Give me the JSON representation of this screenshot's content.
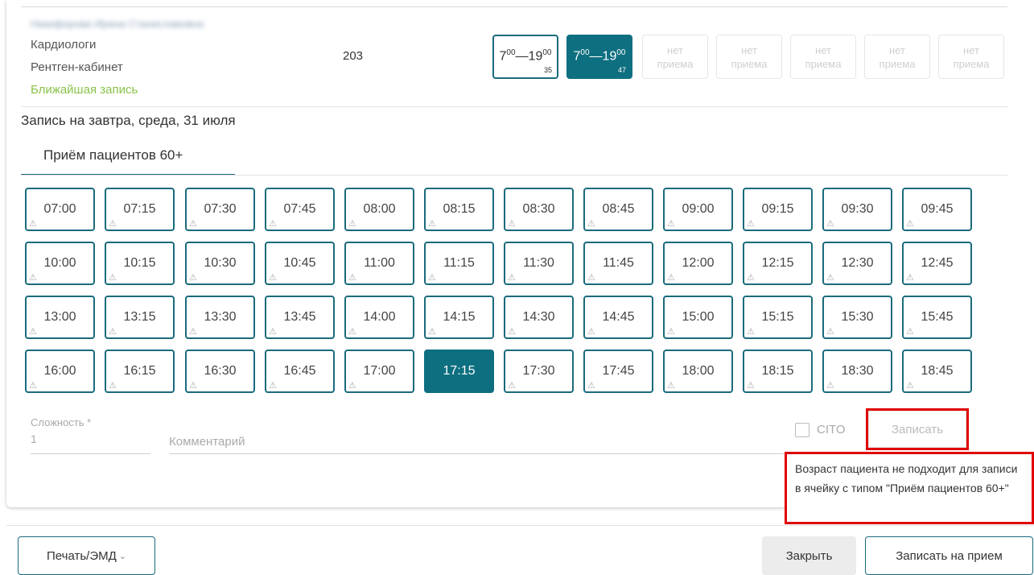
{
  "doctor": {
    "name_blurred": "Никифорова Ирина Станиславовна",
    "specialty": "Кардиологи",
    "cabinet": "Рентген-кабинет",
    "nearest_link": "Ближайшая запись",
    "room": "203"
  },
  "schedule_days": [
    {
      "start_h": "7",
      "start_m": "00",
      "end_h": "19",
      "end_m": "00",
      "count": "35",
      "selected": false
    },
    {
      "start_h": "7",
      "start_m": "00",
      "end_h": "19",
      "end_m": "00",
      "count": "47",
      "selected": true
    },
    {
      "off_line1": "нет",
      "off_line2": "приема"
    },
    {
      "off_line1": "нет",
      "off_line2": "приема"
    },
    {
      "off_line1": "нет",
      "off_line2": "приема"
    },
    {
      "off_line1": "нет",
      "off_line2": "приема"
    },
    {
      "off_line1": "нет",
      "off_line2": "приема"
    }
  ],
  "date_title": "Запись на завтра, среда, 31 июля",
  "tab_label": "Приём пациентов 60+",
  "slots": [
    "07:00",
    "07:15",
    "07:30",
    "07:45",
    "08:00",
    "08:15",
    "08:30",
    "08:45",
    "09:00",
    "09:15",
    "09:30",
    "09:45",
    "10:00",
    "10:15",
    "10:30",
    "10:45",
    "11:00",
    "11:15",
    "11:30",
    "11:45",
    "12:00",
    "12:15",
    "12:30",
    "12:45",
    "13:00",
    "13:15",
    "13:30",
    "13:45",
    "14:00",
    "14:15",
    "14:30",
    "14:45",
    "15:00",
    "15:15",
    "15:30",
    "15:45",
    "16:00",
    "16:15",
    "16:30",
    "16:45",
    "17:00",
    "17:15",
    "17:30",
    "17:45",
    "18:00",
    "18:15",
    "18:30",
    "18:45"
  ],
  "selected_slot": "17:15",
  "warn_icon": "warning-triangle-icon",
  "form": {
    "complexity_label": "Сложность *",
    "complexity_value": "1",
    "comment_placeholder": "Комментарий",
    "cito_label": "CITO",
    "book_label": "Записать"
  },
  "tooltip_text": "Возраст пациента не подходит для записи в ячейку с типом \"Приём пациентов 60+\"",
  "footer": {
    "print_label": "Печать/ЭМД",
    "close_label": "Закрыть",
    "appoint_label": "Записать на прием"
  },
  "colors": {
    "accent": "#0e6f80",
    "nearest_link": "#8bc34a",
    "highlight_border": "#e00000"
  }
}
